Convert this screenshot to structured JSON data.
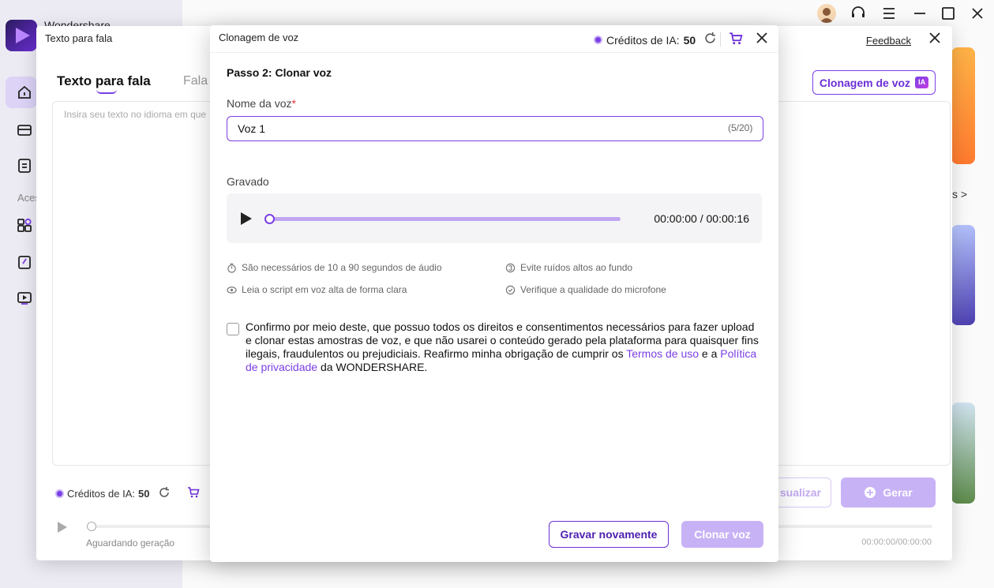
{
  "app": {
    "name": "Wondershare",
    "sidebar_section": "Aces"
  },
  "tts": {
    "window_title": "Texto para fala",
    "feedback": "Feedback",
    "tab_active_pre": "Texto ",
    "tab_active_mid": "para",
    "tab_active_post": " fala",
    "tab_other": "Fala",
    "placeholder": "Insira seu texto no idioma em que",
    "clone_button": "Clonagem de voz",
    "ia_badge": "IA",
    "credits_label": "Créditos de IA:",
    "credits_value": "50",
    "preview_button": "sualizar",
    "generate_button": "Gerar",
    "waiting": "Aguardando geração",
    "time": "00:00:00/00:00:00",
    "side_link": "s >"
  },
  "modal": {
    "title": "Clonagem de voz",
    "credits_label": "Créditos de IA:",
    "credits_value": "50",
    "step_title": "Passo 2: Clonar voz",
    "voice_name_label": "Nome da voz",
    "required_mark": "*",
    "voice_name_value": "Voz 1",
    "char_count": "(5/20)",
    "recorded_label": "Gravado",
    "player_time": "00:00:00 / 00:00:16",
    "player_progress": 0,
    "tips": [
      "São necessários de 10 a 90 segundos de áudio",
      "Evite ruídos altos ao fundo",
      "Leia o script em voz alta de forma clara",
      "Verifique a qualidade do microfone"
    ],
    "consent_text": "Confirmo por meio deste, que possuo todos os direitos e consentimentos necessários para fazer upload e clonar estas amostras de voz, e que não usarei o conteúdo gerado pela plataforma para quaisquer fins ilegais, fraudulentos ou prejudiciais. Reafirmo minha obrigação de cumprir os ",
    "terms_link": "Termos de uso",
    "consent_and": " e a ",
    "privacy_link": "Política de privacidade",
    "consent_end": " da WONDERSHARE.",
    "consent_checked": false,
    "rerecord_button": "Gravar novamente",
    "clone_button": "Clonar voz"
  },
  "colors": {
    "accent": "#7b3fe4",
    "accent_light": "#c8b2f6",
    "required": "#e0353b"
  }
}
